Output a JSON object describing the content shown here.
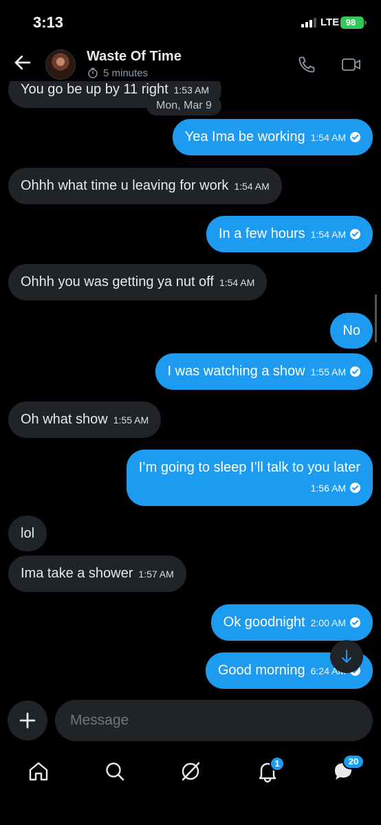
{
  "status": {
    "time": "3:13",
    "network": "LTE",
    "battery": "98"
  },
  "header": {
    "name": "Waste Of Time",
    "disappearing": "5 minutes"
  },
  "messages": {
    "m0": {
      "text": "You go be up by 11 right",
      "time": "1:53 AM"
    },
    "date": "Mon, Mar 9",
    "m1": {
      "text": "Yea Ima be working",
      "time": "1:54 AM"
    },
    "m2": {
      "text": "Ohhh what time u leaving for work",
      "time": "1:54 AM"
    },
    "m3": {
      "text": "In a few hours",
      "time": "1:54 AM"
    },
    "m4": {
      "text": "Ohhh you was getting ya nut off",
      "time": "1:54 AM"
    },
    "m5": {
      "text": "No"
    },
    "m6": {
      "text": "I was watching a show",
      "time": "1:55 AM"
    },
    "m7": {
      "text": "Oh what show",
      "time": "1:55 AM"
    },
    "m8": {
      "text": "I’m going to sleep I’ll talk to you later",
      "time": "1:56 AM"
    },
    "m9": {
      "text": "lol"
    },
    "m10": {
      "text": "Ima take a shower",
      "time": "1:57 AM"
    },
    "m11": {
      "text": "Ok goodnight",
      "time": "2:00 AM"
    },
    "m12": {
      "text": "Good morning",
      "time": "6:24 AM"
    }
  },
  "composer": {
    "placeholder": "Message"
  },
  "nav": {
    "notifications_badge": "1",
    "messages_badge": "20"
  },
  "colors": {
    "accent": "#1d9bf0",
    "incoming": "#202327",
    "background": "#000000"
  }
}
